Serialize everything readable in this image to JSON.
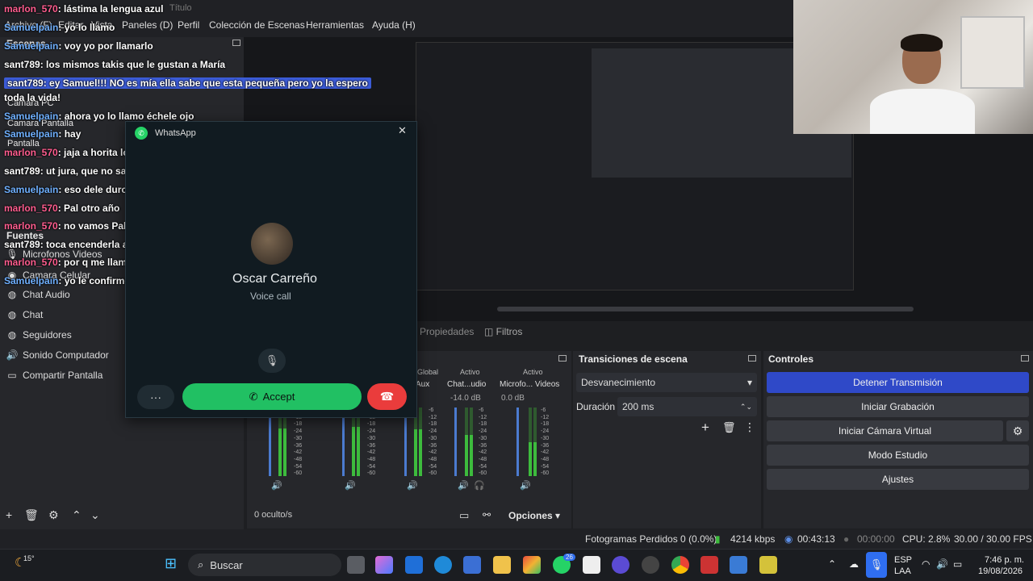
{
  "window": {
    "title": "Título"
  },
  "menu": {
    "items": [
      "Archivo (F)",
      "Editar",
      "Vista",
      "Paneles (D)",
      "Perfil",
      "Colección de Escenas",
      "Herramientas",
      "Ayuda (H)"
    ]
  },
  "scenes": {
    "title": "Escenas",
    "items": [
      "Camara PC",
      "Camara Pantalla",
      "Pantalla"
    ]
  },
  "sources": {
    "title": "Fuentes",
    "items": [
      "Microfonos Videos",
      "Camara Celular",
      "Chat Audio",
      "Chat",
      "Seguidores",
      "Sonido Computador",
      "Compartir Pantalla"
    ]
  },
  "tabs": {
    "properties": "Propiedades",
    "filters": "Filtros"
  },
  "mixer": {
    "status_labels": [
      "Global",
      "Activo",
      "Activo"
    ],
    "channels": [
      {
        "name": "Aux",
        "db": ""
      },
      {
        "name": "Chat...udio",
        "db": "-14.0 dB"
      },
      {
        "name": "Microfo... Videos",
        "db": "0.0 dB"
      }
    ],
    "scale": [
      "-6",
      "-12",
      "-18",
      "-24",
      "-30",
      "-36",
      "-42",
      "-48",
      "-54",
      "-60"
    ],
    "hidden_label": "0 oculto/s",
    "options_label": "Opciones"
  },
  "transitions": {
    "title": "Transiciones de escena",
    "selected": "Desvanecimiento",
    "duration_label": "Duración",
    "duration_value": "200 ms"
  },
  "controls": {
    "title": "Controles",
    "buttons": [
      "Detener Transmisión",
      "Iniciar Grabación",
      "Iniciar Cámara Virtual",
      "Modo Estudio",
      "Ajustes"
    ]
  },
  "status": {
    "dropped": "Fotogramas Perdidos 0 (0.0%)",
    "bitrate": "4214 kbps",
    "stream_time": "00:43:13",
    "record_time": "00:00:00",
    "cpu": "CPU: 2.8%",
    "fps": "30.00 / 30.00 FPS"
  },
  "chat": [
    {
      "user": "marlon_570",
      "msg": ": lástima la lengua azul"
    },
    {
      "user": "Samuelpain",
      "msg": ": yo lo llamo"
    },
    {
      "user": "Samuelpain",
      "msg": ": voy yo por llamarlo"
    },
    {
      "user": "sant789",
      "msg": ": los mismos takis que le gustan a María"
    },
    {
      "user": "sant789",
      "msg": ": ey Samuel!!! NO es mía ella sabe que esta pequeña pero yo la espero"
    },
    {
      "user": "",
      "msg": "toda la vida!"
    },
    {
      "user": "Samuelpain",
      "msg": ": ahora yo lo llamo échele ojo"
    },
    {
      "user": "Samuelpain",
      "msg": ": hay"
    },
    {
      "user": "marlon_570",
      "msg": ": jaja a horita lo llama los abuelos"
    },
    {
      "user": "sant789",
      "msg": ": ut jura, que no sabe que pasó en salitre"
    },
    {
      "user": "Samuelpain",
      "msg": ": eso dele duro Oscar o si no yo le doy aaaaaa"
    },
    {
      "user": "marlon_570",
      "msg": ": Pal otro año"
    },
    {
      "user": "marlon_570",
      "msg": ": no vamos Pal autódromo a practicar"
    },
    {
      "user": "sant789",
      "msg": ": toca encenderla a chimbo pa que ajuicie y no llame"
    },
    {
      "user": "marlon_570",
      "msg": ": por q me llamaron"
    },
    {
      "user": "Samuelpain",
      "msg": ": yo le confirmo no digo nada mas"
    }
  ],
  "whatsapp": {
    "app": "WhatsApp",
    "caller": "Oscar Carreño",
    "call_type": "Voice call",
    "accept": "Accept"
  },
  "taskbar": {
    "weather": "15°",
    "search": "Buscar",
    "badge": "26",
    "lang1": "ESP",
    "lang2": "LAA",
    "time": "7:46 p. m.",
    "date": "19/08/2026"
  },
  "colors": {
    "accent": "#2f49c8",
    "accept": "#21c063",
    "decline": "#ea3c3c",
    "user_marlon": "#ff5d8f",
    "user_samuel": "#6fb0ff",
    "user_sant": "#ffffff"
  }
}
